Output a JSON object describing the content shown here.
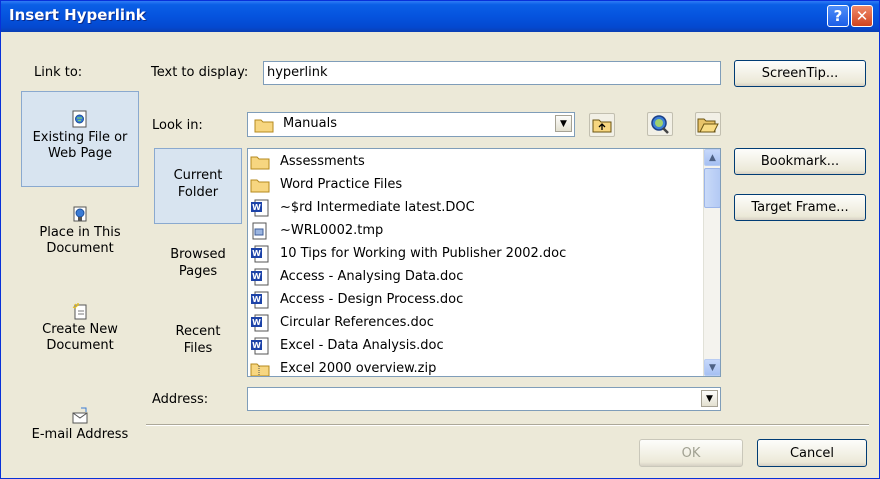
{
  "window": {
    "title": "Insert Hyperlink",
    "help_glyph": "?",
    "close_glyph": "✕"
  },
  "link_to": {
    "label": "Link to:",
    "items": [
      {
        "line1": "Existing File or",
        "line2": "Web Page",
        "icon": "existing-file-icon",
        "selected": true
      },
      {
        "line1": "Place in This",
        "line2": "Document",
        "icon": "place-in-document-icon",
        "selected": false
      },
      {
        "line1": "Create New",
        "line2": "Document",
        "icon": "create-new-document-icon",
        "selected": false
      },
      {
        "line1": "E-mail Address",
        "line2": "",
        "icon": "email-address-icon",
        "selected": false
      }
    ]
  },
  "text_to_display": {
    "label": "Text to display:",
    "value": "hyperlink"
  },
  "screentip_button": "ScreenTip...",
  "look_in": {
    "label": "Look in:",
    "value": "Manuals",
    "dropdown_glyph": "▼"
  },
  "inner_nav": [
    {
      "line1": "Current",
      "line2": "Folder",
      "selected": true
    },
    {
      "line1": "Browsed",
      "line2": "Pages",
      "selected": false
    },
    {
      "line1": "Recent",
      "line2": "Files",
      "selected": false
    }
  ],
  "files": [
    {
      "name": "Assessments",
      "icon": "folder-icon"
    },
    {
      "name": "Word Practice Files",
      "icon": "folder-icon"
    },
    {
      "name": "~$rd Intermediate latest.DOC",
      "icon": "word-doc-icon"
    },
    {
      "name": "~WRL0002.tmp",
      "icon": "tmp-file-icon"
    },
    {
      "name": "10 Tips for Working with Publisher 2002.doc",
      "icon": "word-doc-icon"
    },
    {
      "name": "Access - Analysing Data.doc",
      "icon": "word-doc-icon"
    },
    {
      "name": "Access - Design Process.doc",
      "icon": "word-doc-icon"
    },
    {
      "name": "Circular References.doc",
      "icon": "word-doc-icon"
    },
    {
      "name": "Excel  - Data Analysis.doc",
      "icon": "word-doc-icon"
    },
    {
      "name": "Excel 2000 overview.zip",
      "icon": "zip-folder-icon"
    }
  ],
  "right_buttons": {
    "bookmark": "Bookmark...",
    "target_frame": "Target Frame..."
  },
  "address": {
    "label": "Address:",
    "value": "",
    "dropdown_glyph": "▼"
  },
  "footer": {
    "ok": "OK",
    "cancel": "Cancel"
  },
  "colors": {
    "title_bar": "#0553de",
    "dialog_bg": "#ece9d8",
    "selected_item_bg": "#d8e4f0"
  }
}
